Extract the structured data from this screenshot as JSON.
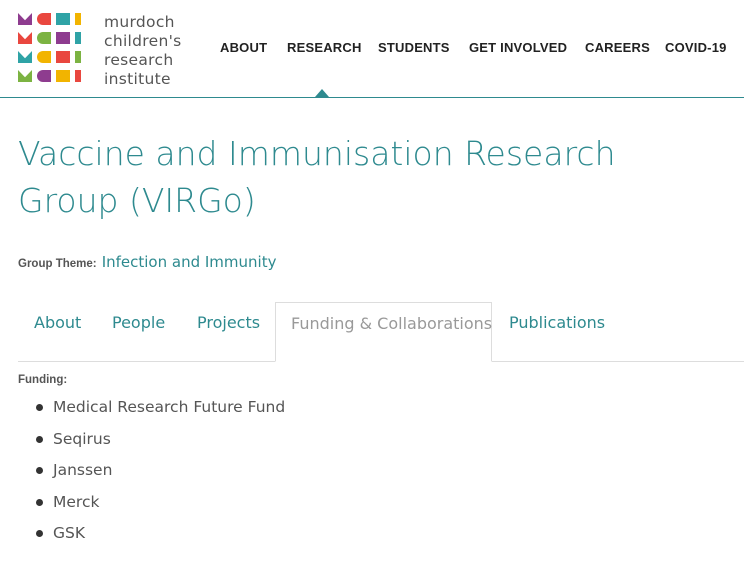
{
  "logo": {
    "lines": [
      "murdoch",
      "children's",
      "research",
      "institute"
    ],
    "colors": [
      "#e9473f",
      "#2fa3a6",
      "#f2b400",
      "#7cb342",
      "#8e3c8f"
    ]
  },
  "nav": {
    "items": [
      "ABOUT",
      "RESEARCH",
      "STUDENTS",
      "GET INVOLVED",
      "CAREERS",
      "COVID-19"
    ],
    "active": "RESEARCH"
  },
  "page": {
    "title": "Vaccine and Immunisation Research Group (VIRGo)",
    "theme_label": "Group Theme:",
    "theme_value": "Infection and Immunity"
  },
  "tabs": {
    "items": [
      "About",
      "People",
      "Projects",
      "Funding & Collaborations",
      "Publications"
    ],
    "active": "Funding & Collaborations"
  },
  "funding": {
    "label": "Funding:",
    "items": [
      "Medical Research Future Fund",
      "Seqirus",
      "Janssen",
      "Merck",
      "GSK"
    ]
  },
  "colors": {
    "accent": "#2e8a8f",
    "text": "#555555"
  }
}
